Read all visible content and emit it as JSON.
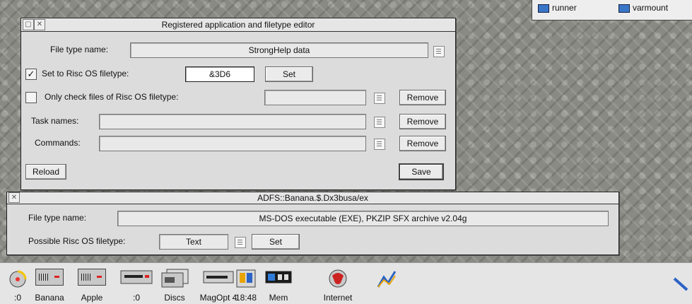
{
  "topright": {
    "item1": "runner",
    "item2": "varmount"
  },
  "win1": {
    "title": "Registered application and filetype editor",
    "file_type_name_label": "File type name:",
    "file_type_name_value": "StrongHelp data",
    "set_filetype_checked": true,
    "set_filetype_check_mark": "✓",
    "set_filetype_label": "Set to Risc OS filetype:",
    "set_filetype_value": "&3D6",
    "set_button": "Set",
    "only_check_label": "Only check files of Risc OS filetype:",
    "only_check_value": "",
    "remove_button_1": "Remove",
    "task_names_label": "Task names:",
    "task_names_value": "",
    "remove_button_2": "Remove",
    "commands_label": "Commands:",
    "commands_value": "",
    "remove_button_3": "Remove",
    "reload_button": "Reload",
    "save_button": "Save"
  },
  "win2": {
    "title": "ADFS::Banana.$.Dx3busa/ex",
    "file_type_name_label": "File type name:",
    "file_type_name_value": "MS-DOS executable (EXE), PKZIP SFX archive v2.04g",
    "possible_label": "Possible Risc OS filetype:",
    "possible_value": "Text",
    "set_button": "Set"
  },
  "iconbar": {
    "items": [
      {
        "label": ":0",
        "icon": "cd-drive-icon"
      },
      {
        "label": "Banana",
        "icon": "hard-disc-icon"
      },
      {
        "label": "Apple",
        "icon": "hard-disc-icon"
      },
      {
        "label": ":0",
        "icon": "floppy-drive-icon"
      },
      {
        "label": "Discs",
        "icon": "discs-icon"
      },
      {
        "label": "MagOpt 4",
        "icon": "magneto-optical-icon"
      },
      {
        "label": "18:48",
        "icon": "clock-icon"
      },
      {
        "label": "Mem",
        "icon": "memory-icon"
      },
      {
        "label": "Internet",
        "icon": "internet-icon"
      },
      {
        "label": "",
        "icon": "graph-icon"
      }
    ]
  }
}
